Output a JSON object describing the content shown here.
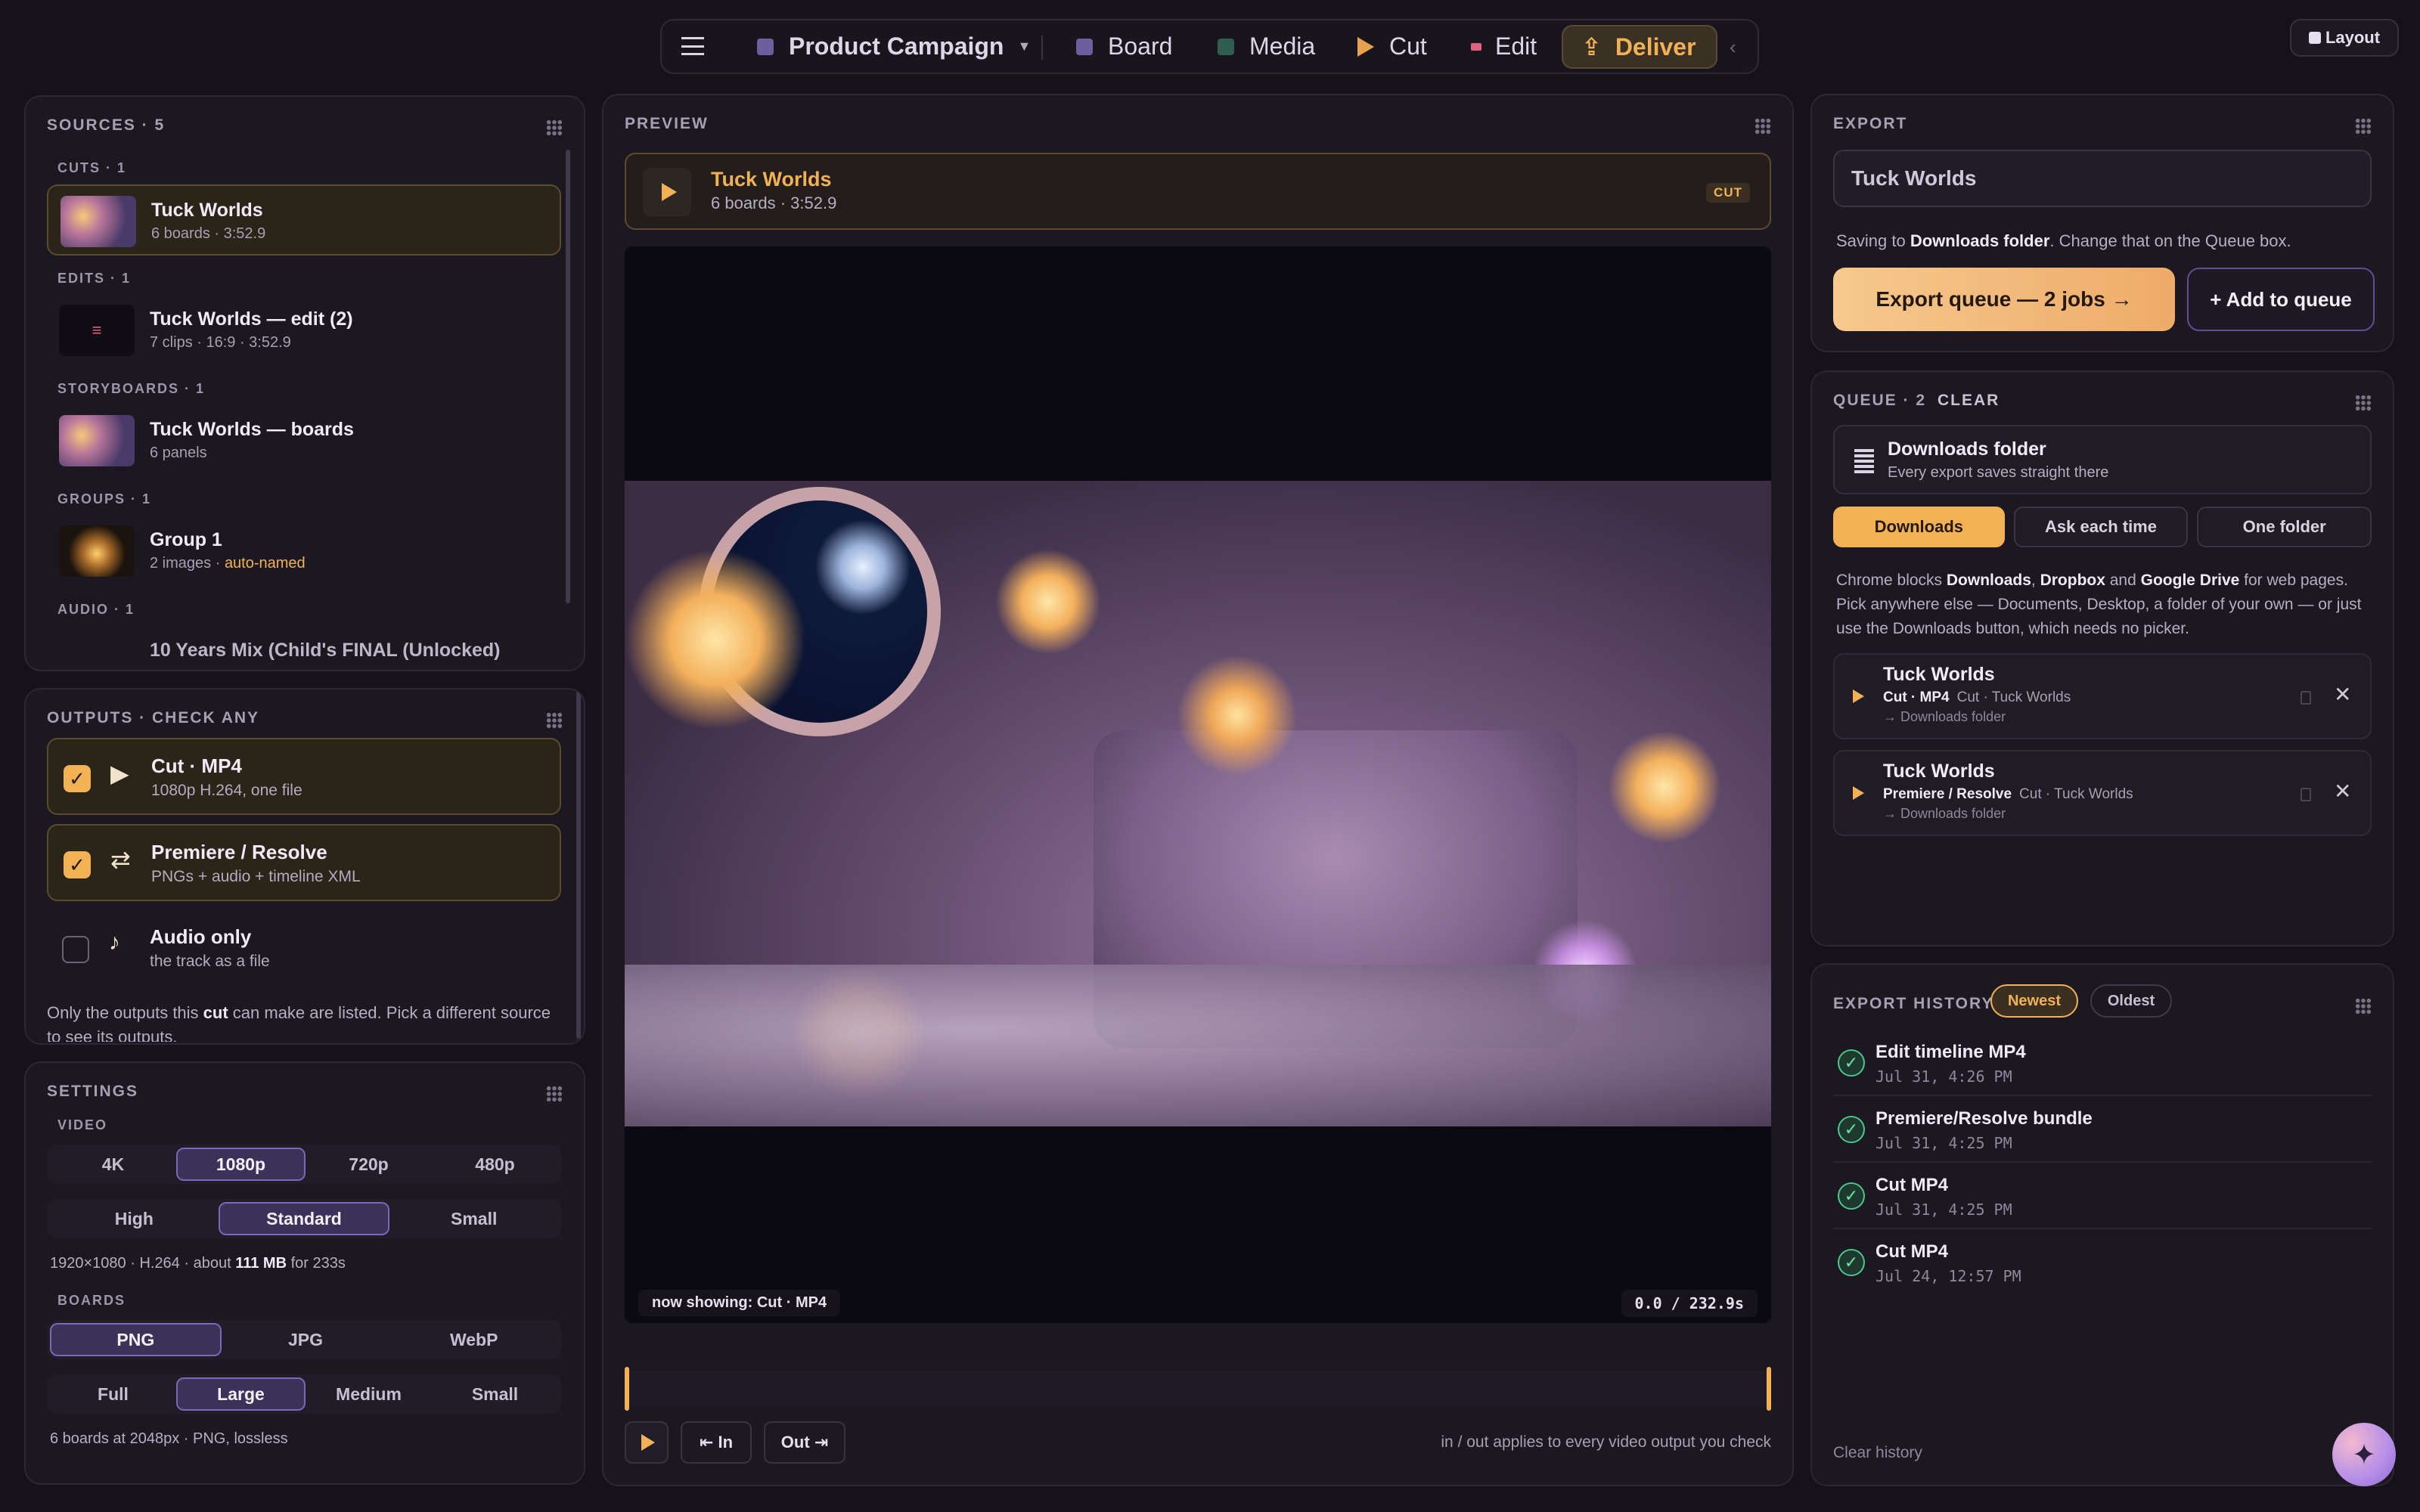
{
  "topbar": {
    "project": "Product Campaign",
    "tabs": [
      {
        "label": "Board",
        "color": "#6b5fa0"
      },
      {
        "label": "Media",
        "color": "#2f5d50"
      },
      {
        "label": "Cut",
        "color": "#e7a24f"
      },
      {
        "label": "Edit",
        "color": "#e06080"
      },
      {
        "label": "Deliver",
        "color": "#f2b155"
      }
    ],
    "layout_label": "Layout"
  },
  "sources": {
    "title": "SOURCES · 5",
    "sections": [
      "CUTS · 1",
      "EDITS · 1",
      "STORYBOARDS · 1",
      "GROUPS · 1",
      "AUDIO · 1"
    ],
    "items": [
      {
        "title": "Tuck Worlds",
        "sub": "6 boards · 3:52.9"
      },
      {
        "title": "Tuck Worlds — edit (2)",
        "sub": "7 clips · 16:9 · 3:52.9"
      },
      {
        "title": "Tuck Worlds — boards",
        "sub": "6 panels"
      },
      {
        "title": "Group 1",
        "sub": "2 images · ",
        "sub_accent": "auto-named"
      },
      {
        "title": "10 Years Mix (Child's FINAL (Unlocked)"
      }
    ]
  },
  "outputs": {
    "title": "OUTPUTS · CHECK ANY",
    "items": [
      {
        "title": "Cut · MP4",
        "sub": "1080p H.264, one file",
        "checked": true
      },
      {
        "title": "Premiere / Resolve",
        "sub": "PNGs + audio + timeline XML",
        "checked": true
      },
      {
        "title": "Audio only",
        "sub": "the track as a file",
        "checked": false
      }
    ],
    "note_pre": "Only the outputs this ",
    "note_bold": "cut",
    "note_post": " can make are listed. Pick a different source to see its outputs."
  },
  "settings": {
    "title": "SETTINGS",
    "video_label": "VIDEO",
    "resolutions": [
      "4K",
      "1080p",
      "720p",
      "480p"
    ],
    "res_selected": "1080p",
    "qualities": [
      "High",
      "Standard",
      "Small"
    ],
    "quality_selected": "Standard",
    "video_info_pre": "1920×1080 · H.264 · about ",
    "video_info_bold": "111 MB",
    "video_info_post": " for 233s",
    "boards_label": "BOARDS",
    "formats": [
      "PNG",
      "JPG",
      "WebP"
    ],
    "format_selected": "PNG",
    "sizes": [
      "Full",
      "Large",
      "Medium",
      "Small"
    ],
    "size_selected": "Large",
    "boards_info": "6 boards at 2048px · PNG, lossless"
  },
  "preview": {
    "title": "PREVIEW",
    "clip_title": "Tuck Worlds",
    "clip_sub": "6 boards · 3:52.9",
    "badge": "CUT",
    "now_showing": "now showing: Cut · MP4",
    "timecode": "0.0 / 232.9s",
    "in_label": "⇤ In",
    "out_label": "Out ⇥",
    "hint": "in / out applies to every video output you check"
  },
  "export": {
    "title": "EXPORT",
    "name_value": "Tuck Worlds",
    "saving_pre": "Saving to ",
    "saving_bold": "Downloads folder",
    "saving_post": ". Change that on the Queue box.",
    "export_btn": "Export queue — 2 jobs →",
    "add_btn": "+ Add to queue"
  },
  "queue": {
    "title": "QUEUE · 2",
    "clear": "CLEAR",
    "dest_title": "Downloads folder",
    "dest_sub": "Every export saves straight there",
    "modes": [
      "Downloads",
      "Ask each time",
      "One folder"
    ],
    "mode_selected": "Downloads",
    "note": [
      "Chrome blocks ",
      "Downloads",
      ", ",
      "Dropbox",
      " and ",
      "Google Drive",
      " for web pages. Pick anywhere else — Documents, Desktop, a folder of your own — or just use the Downloads button, which needs no picker."
    ],
    "jobs": [
      {
        "title": "Tuck Worlds",
        "kind": "Cut · MP4",
        "src": "Cut · Tuck Worlds",
        "dest": "→ Downloads folder"
      },
      {
        "title": "Tuck Worlds",
        "kind": "Premiere / Resolve",
        "src": "Cut · Tuck Worlds",
        "dest": "→ Downloads folder"
      }
    ]
  },
  "history": {
    "title": "EXPORT HISTORY",
    "sort": [
      "Newest",
      "Oldest"
    ],
    "sort_selected": "Newest",
    "items": [
      {
        "title": "Edit timeline MP4",
        "date": "Jul 31, 4:26 PM"
      },
      {
        "title": "Premiere/Resolve bundle",
        "date": "Jul 31, 4:25 PM"
      },
      {
        "title": "Cut MP4",
        "date": "Jul 31, 4:25 PM"
      },
      {
        "title": "Cut MP4",
        "date": "Jul 24, 12:57 PM"
      }
    ],
    "clear": "Clear history"
  },
  "colors": {
    "accent": "#f2b155",
    "purple": "#7a67b5",
    "bg": "#15121a"
  }
}
